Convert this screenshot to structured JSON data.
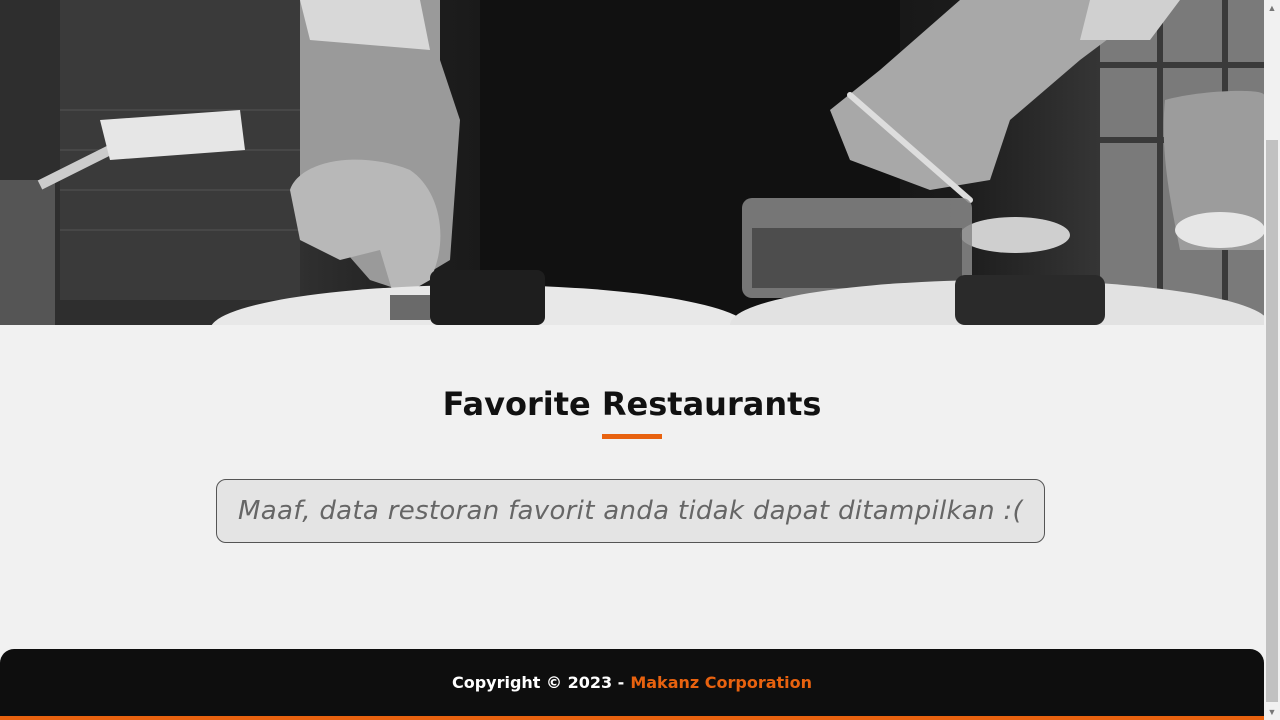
{
  "hero": {
    "image_name": "chefs-plating-food-image"
  },
  "main": {
    "title": "Favorite Restaurants",
    "empty_message": "Maaf, data restoran favorit anda tidak dapat ditampilkan :("
  },
  "footer": {
    "copyright": "Copyright © 2023 -",
    "brand": "Makanz Corporation"
  },
  "colors": {
    "accent": "#e8620f",
    "footer_bg": "#0e0e0e",
    "page_bg": "#f1f1f1"
  },
  "scrollbar": {
    "up_icon": "▲",
    "down_icon": "▼"
  }
}
